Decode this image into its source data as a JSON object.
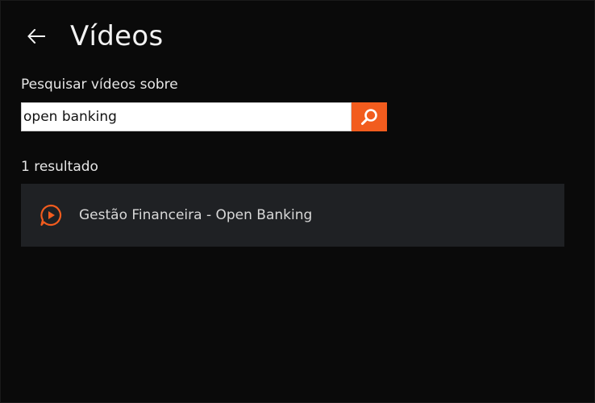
{
  "header": {
    "title": "Vídeos",
    "back_icon": "arrow-left-icon"
  },
  "search": {
    "label": "Pesquisar vídeos sobre",
    "value": "open banking",
    "button_icon": "search-icon",
    "accent_color": "#f25c1e"
  },
  "results": {
    "count_text": "1 resultado",
    "items": [
      {
        "title": "Gestão Financeira - Open Banking",
        "icon": "video-play-icon"
      }
    ]
  }
}
